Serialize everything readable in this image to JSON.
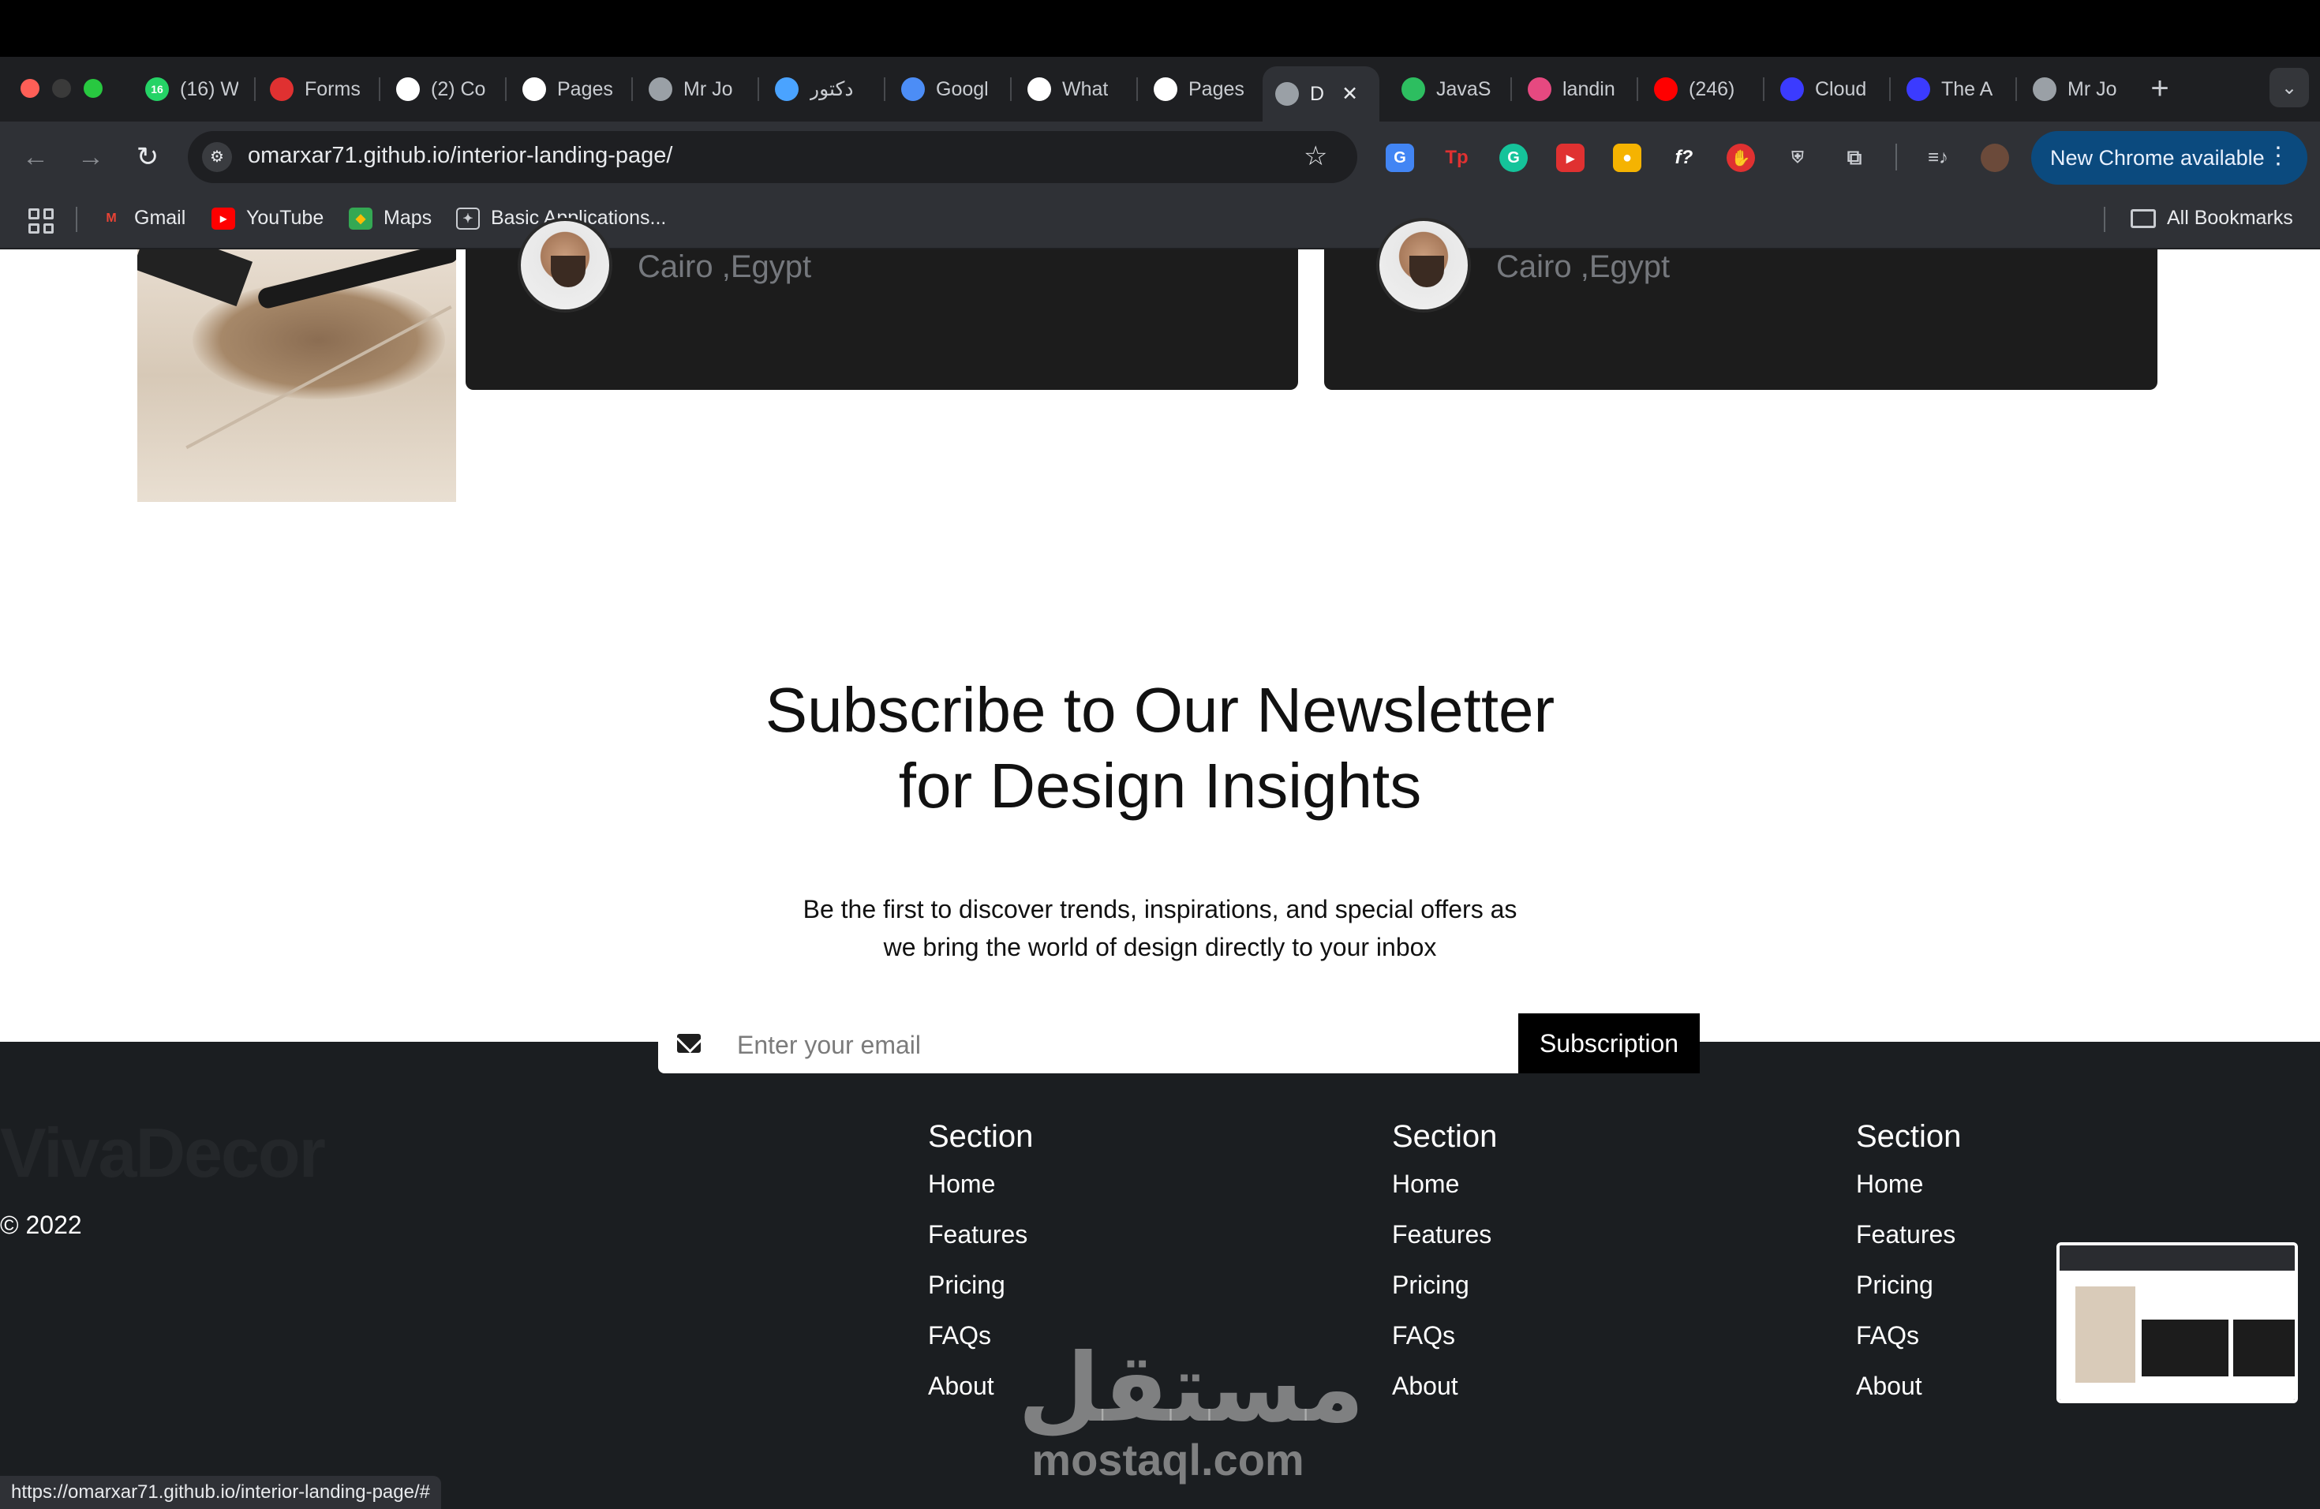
{
  "browser": {
    "tabs": [
      {
        "title": "(16) W",
        "icon": "whatsapp-icon",
        "color": "#25d366",
        "badge": "16"
      },
      {
        "title": "Forms",
        "icon": "forms-icon",
        "color": "#e03131"
      },
      {
        "title": "(2) Co",
        "icon": "notion-icon",
        "color": "#ffffff"
      },
      {
        "title": "Pages",
        "icon": "github-icon",
        "color": "#ffffff"
      },
      {
        "title": "Mr Jo",
        "icon": "globe-icon",
        "color": "#9aa0a6"
      },
      {
        "title": "دكتور",
        "icon": "swirl-icon",
        "color": "#4aa3ff"
      },
      {
        "title": "Googl",
        "icon": "gemini-icon",
        "color": "#4c8df6"
      },
      {
        "title": "What",
        "icon": "chatgpt-icon",
        "color": "#ffffff"
      },
      {
        "title": "Pages",
        "icon": "github-icon",
        "color": "#ffffff"
      },
      {
        "title": "D",
        "icon": "globe-icon",
        "color": "#9aa0a6",
        "active": true
      },
      {
        "title": "JavaS",
        "icon": "evernote-icon",
        "color": "#2dbe60"
      },
      {
        "title": "landin",
        "icon": "grammarly-icon",
        "color": "#e64980"
      },
      {
        "title": "(246)",
        "icon": "youtube-icon",
        "color": "#ff0000"
      },
      {
        "title": "Cloud",
        "icon": "cloud-icon",
        "color": "#3b3bff"
      },
      {
        "title": "The A",
        "icon": "cloud-icon",
        "color": "#3b3bff"
      },
      {
        "title": "Mr Jo",
        "icon": "globe-icon",
        "color": "#9aa0a6"
      }
    ],
    "url": "omarxar71.github.io/interior-landing-page/",
    "new_chrome_label": "New Chrome available",
    "bookmarks": [
      {
        "label": "Gmail",
        "icon": "gmail-icon"
      },
      {
        "label": "YouTube",
        "icon": "youtube-icon"
      },
      {
        "label": "Maps",
        "icon": "maps-icon"
      },
      {
        "label": "Basic Applications...",
        "icon": "app-icon"
      }
    ],
    "all_bookmarks_label": "All Bookmarks",
    "status_url": "https://omarxar71.github.io/interior-landing-page/#"
  },
  "testimonials": [
    {
      "location": "Cairo ,Egypt"
    },
    {
      "location": "Cairo ,Egypt"
    }
  ],
  "newsletter": {
    "title_line1": "Subscribe to Our Newsletter",
    "title_line2": "for Design Insights",
    "desc_line1": "Be the first to discover trends, inspirations, and special offers as",
    "desc_line2": "we bring the world of design directly to your inbox",
    "email_placeholder": "Enter your email",
    "button_label": "Subscription"
  },
  "footer": {
    "logo": "VivaDecor",
    "copyright": "© 2022",
    "columns": [
      {
        "heading": "Section",
        "links": [
          "Home",
          "Features",
          "Pricing",
          "FAQs",
          "About"
        ]
      },
      {
        "heading": "Section",
        "links": [
          "Home",
          "Features",
          "Pricing",
          "FAQs",
          "About"
        ]
      },
      {
        "heading": "Section",
        "links": [
          "Home",
          "Features",
          "Pricing",
          "FAQs",
          "About"
        ]
      }
    ]
  },
  "watermark": {
    "arabic": "مستقل",
    "latin": "mostaql.com"
  }
}
